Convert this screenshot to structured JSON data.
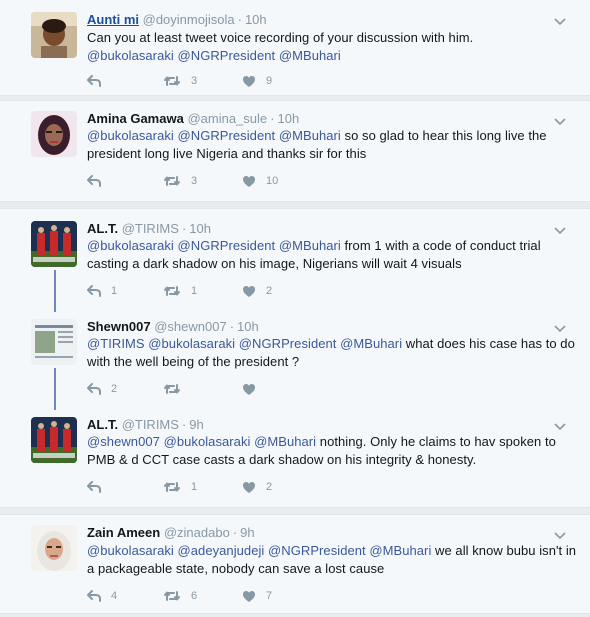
{
  "tweets": [
    {
      "name": "Aunti mi",
      "handle": "@doyinmojisola",
      "time": "10h",
      "text": [
        {
          "t": "Can you at least tweet voice recording of your discussion with him.",
          "m": false
        },
        {
          "t": "\n",
          "m": false
        },
        {
          "t": "@bukolasaraki",
          "m": true
        },
        {
          "t": " ",
          "m": false
        },
        {
          "t": "@NGRPresident",
          "m": true
        },
        {
          "t": " ",
          "m": false
        },
        {
          "t": "@MBuhari",
          "m": true
        }
      ],
      "reply_count": "",
      "retweet_count": "3",
      "like_count": "9"
    },
    {
      "name": "Amina Gamawa",
      "handle": "@amina_sule",
      "time": "10h",
      "text": [
        {
          "t": "@bukolasaraki",
          "m": true
        },
        {
          "t": " ",
          "m": false
        },
        {
          "t": "@NGRPresident",
          "m": true
        },
        {
          "t": " ",
          "m": false
        },
        {
          "t": "@MBuhari",
          "m": true
        },
        {
          "t": " so so glad to hear this long live the president long live Nigeria and thanks sir for this",
          "m": false
        }
      ],
      "reply_count": "",
      "retweet_count": "3",
      "like_count": "10"
    },
    {
      "name": "AL.T.",
      "handle": "@TIRIMS",
      "time": "10h",
      "text": [
        {
          "t": "@bukolasaraki",
          "m": true
        },
        {
          "t": " ",
          "m": false
        },
        {
          "t": "@NGRPresident",
          "m": true
        },
        {
          "t": " ",
          "m": false
        },
        {
          "t": "@MBuhari",
          "m": true
        },
        {
          "t": " from 1 with a code of conduct trial casting a dark shadow on his image, Nigerians will wait 4 visuals",
          "m": false
        }
      ],
      "reply_count": "1",
      "retweet_count": "1",
      "like_count": "2"
    },
    {
      "name": "Shewn007",
      "handle": "@shewn007",
      "time": "10h",
      "text": [
        {
          "t": "@TIRIMS",
          "m": true
        },
        {
          "t": " ",
          "m": false
        },
        {
          "t": "@bukolasaraki",
          "m": true
        },
        {
          "t": " ",
          "m": false
        },
        {
          "t": "@NGRPresident",
          "m": true
        },
        {
          "t": " ",
          "m": false
        },
        {
          "t": "@MBuhari",
          "m": true
        },
        {
          "t": " what does his case has to do with the well being of the president ?",
          "m": false
        }
      ],
      "reply_count": "2",
      "retweet_count": "",
      "like_count": ""
    },
    {
      "name": "AL.T.",
      "handle": "@TIRIMS",
      "time": "9h",
      "text": [
        {
          "t": "@shewn007",
          "m": true
        },
        {
          "t": " ",
          "m": false
        },
        {
          "t": "@bukolasaraki",
          "m": true
        },
        {
          "t": " ",
          "m": false
        },
        {
          "t": "@MBuhari",
          "m": true
        },
        {
          "t": " nothing. Only he claims to hav spoken to PMB & d CCT case casts a dark shadow on  his integrity & honesty.",
          "m": false
        }
      ],
      "reply_count": "",
      "retweet_count": "1",
      "like_count": "2"
    },
    {
      "name": "Zain Ameen",
      "handle": "@zinadabo",
      "time": "9h",
      "text": [
        {
          "t": "@bukolasaraki",
          "m": true
        },
        {
          "t": " ",
          "m": false
        },
        {
          "t": "@adeyanjudeji",
          "m": true
        },
        {
          "t": " ",
          "m": false
        },
        {
          "t": "@NGRPresident",
          "m": true
        },
        {
          "t": " ",
          "m": false
        },
        {
          "t": "@MBuhari",
          "m": true
        },
        {
          "t": " we all know bubu isn't in a packageable state, nobody can save a lost cause",
          "m": false
        }
      ],
      "reply_count": "4",
      "retweet_count": "6",
      "like_count": "7"
    }
  ],
  "separator": "·",
  "colors": {
    "mention": "#3b5998",
    "muted": "#8899a6",
    "thread_line": "#6f86c3",
    "background": "#f5f8fa"
  },
  "icons": [
    "reply-icon",
    "retweet-icon",
    "like-icon",
    "chevron-down-icon"
  ]
}
